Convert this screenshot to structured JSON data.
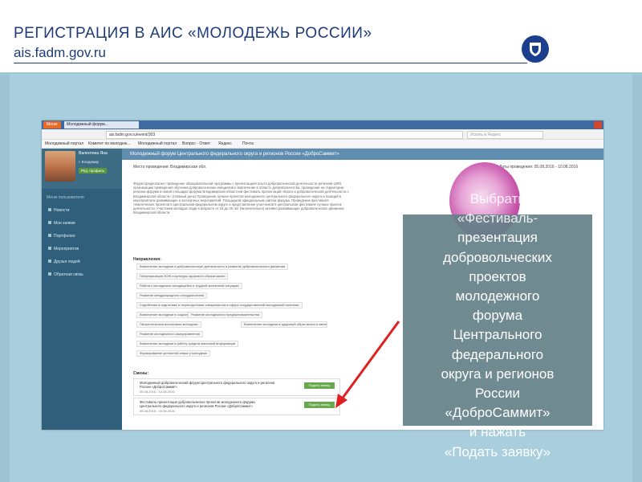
{
  "slide": {
    "title": "РЕГИСТРАЦИЯ В АИС «МОЛОДЕЖЬ РОССИИ»",
    "url": "ais.fadm.gov.ru",
    "accent": "#1f3b78",
    "logo_icon": "shield-icon"
  },
  "browser": {
    "tab_active": "Меню",
    "tab_title": "Молодежный форум...",
    "address": "ais.fadm.gov.ru/event/303",
    "search_placeholder": "Искать в Яндекс",
    "bookmarks": [
      "Молодежный портал",
      "Комитет по молодеж...",
      "Молодежный портал",
      "Вопрос - Ответ",
      "Яндекс",
      "Почта"
    ]
  },
  "sidebar": {
    "user_name": "Валентина Яна",
    "user_city": "г. Владимир",
    "edit_button": "Ред. профиль",
    "section_label": "Меню пользователя",
    "items": [
      {
        "label": "Новости"
      },
      {
        "label": "Мои заявки"
      },
      {
        "label": "Портфолио"
      },
      {
        "label": "Мероприятия"
      },
      {
        "label": "Друзья людей"
      },
      {
        "label": "Обратная связь"
      }
    ]
  },
  "main": {
    "banner": "Молодежный форум Центрального федерального округа и регионов России «ДоброСаммит»",
    "place": "Место проведения: Владимирская обл.",
    "dates": "Даты проведения: 05.08.2016 - 10.08.2016",
    "description": "Форум предполагает проведение образовательной программы с презентацией опыта добровольческой деятельности регионов ЦФО, организацию проведения обучения добровольческих инициатив и вовлечение в область добровольчества, проведение на территории региона форума в новой площадке форума Владимирская областной фестиваль презентаций «Благо и добровольческой деятельности с Владимирской области» (главный день) Проведение лучших проектов молодежного центрального федерального округа и позиций в мероприятиях развивающих и экспертных мероприятий. Площадкой официальным сайтом форума. Проведение фестиваля тематических проектов в Центральном федеральном округе и представление участников в центральном фестивале лучших практик деятельности. Участники молодые люди в возрасте от 18 до 30 лет (включительно) активно развивающие добровольческое движение Владимирской области.",
    "directions_heading": "Направления:",
    "directions": [
      "Вовлечение молодежи в добровольческую деятельность и развитие добровольческого движения",
      "Популяризация ЗОЖ и культуры здорового образа жизни",
      "Работа с молодежью находящейся в трудной жизненной ситуации",
      "Развитие международного сотрудничества",
      "Содействие в подготовке и переподготовке специалистов в сфере государственной молодежной политики",
      "Вовлечение молодежи в социальную практику",
      "Развитие молодежного предпринимательства",
      "Патриотическое воспитание молодежи",
      "Вовлечение молодежи в здоровый образ жизни и занятия спортом",
      "Развитие молодежного самоуправления",
      "Вовлечение молодежи в работу средств массовой информации",
      "Формирование ценностей семьи у молодежи"
    ],
    "forums_heading": "Смены:",
    "forums": [
      {
        "title": "Молодежный добровольческий форум Центрального федерального округа и регионов России «ДоброСаммит»",
        "dates": "05.08.2016 - 10.08.2016",
        "button": "Подать заявку"
      },
      {
        "title": "Фестиваль-презентация добровольческих проектов молодежного форума Центрального федерального округа и регионов России «ДоброСаммит»",
        "dates": "05.08.2016 - 10.08.2016",
        "button": "Подать заявку"
      }
    ]
  },
  "callout": {
    "lines": [
      "Выбрать",
      "«Фестиваль-",
      "презентация",
      "добровольческих",
      "проектов",
      "молодежного",
      "форума",
      "Центрального",
      "федерального",
      "округа и регионов",
      "России",
      "«ДоброСаммит»",
      "и нажать",
      "«Подать заявку»"
    ],
    "arrow_color": "#e02020"
  }
}
